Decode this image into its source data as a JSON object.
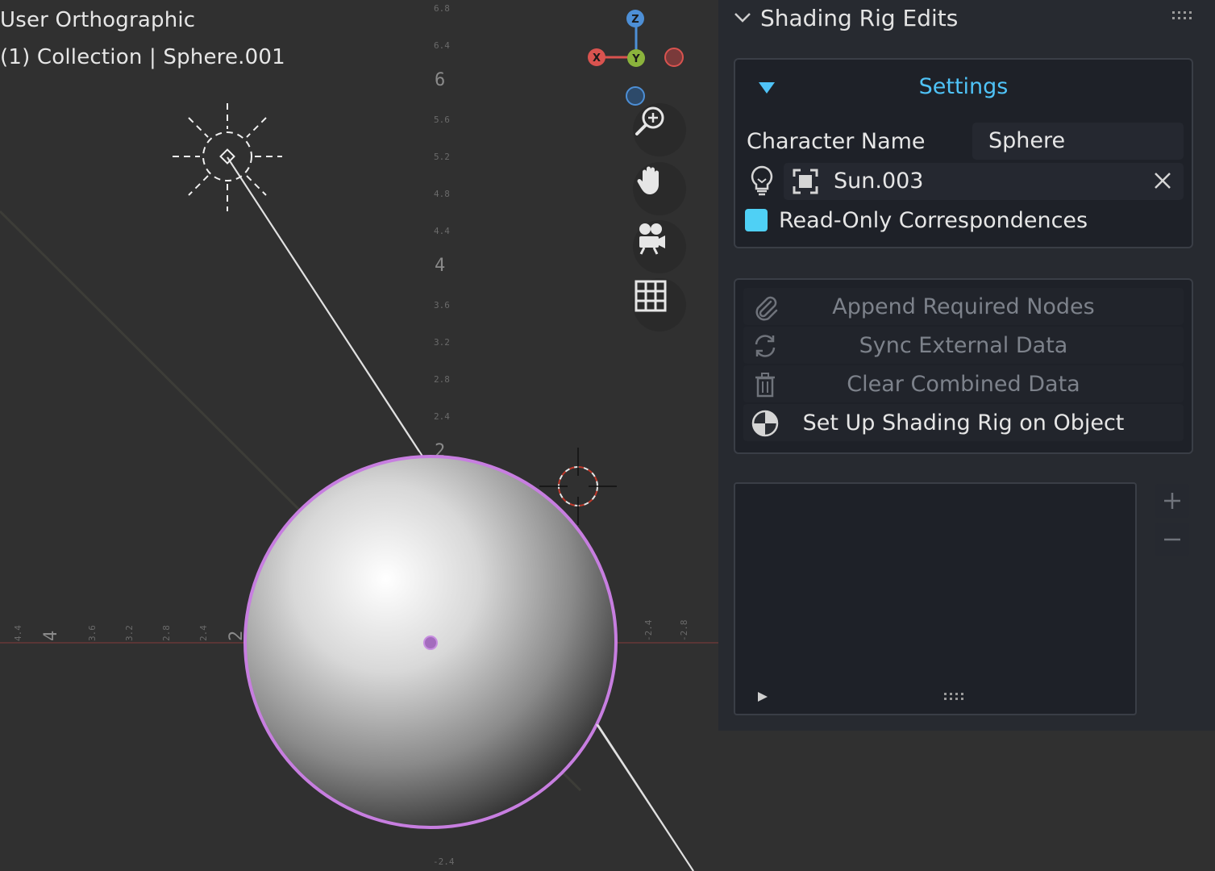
{
  "viewport": {
    "view_name": "User Orthographic",
    "collection_line": "(1) Collection | Sphere.001",
    "gizmo_labels": {
      "x": "X",
      "y": "Y",
      "z": "Z"
    },
    "ruler_vertical": [
      "6.8",
      "6.4",
      "6",
      "5.6",
      "5.2",
      "4.8",
      "4.4",
      "4",
      "3.6",
      "3.2",
      "2.8",
      "2.4",
      "2",
      "-2.4"
    ],
    "ruler_horizontal": [
      "4.4",
      "4",
      "3.6",
      "3.2",
      "2.8",
      "2.4",
      "2",
      "-2.4",
      "-2.8"
    ],
    "colors": {
      "background": "#303030",
      "selection_outline": "#c77ee0",
      "x_axis": "#d9534f",
      "y_axis": "#8bb33c",
      "z_axis": "#4d8fd6"
    },
    "nav_icons": [
      "zoom-icon",
      "pan-hand-icon",
      "camera-icon",
      "grid-icon"
    ]
  },
  "sidebar": {
    "panel_title": "Shading Rig Edits",
    "settings": {
      "label": "Settings",
      "character_name_label": "Character Name",
      "character_name_value": "Sphere",
      "light_object_value": "Sun.003",
      "read_only_label": "Read-Only Correspondences",
      "read_only_checked": true
    },
    "actions": [
      {
        "label": "Append Required Nodes",
        "icon": "paperclip-icon",
        "enabled": false
      },
      {
        "label": "Sync External Data",
        "icon": "sync-icon",
        "enabled": false
      },
      {
        "label": "Clear Combined Data",
        "icon": "trash-icon",
        "enabled": false
      },
      {
        "label": "Set Up Shading Rig on Object",
        "icon": "shading-icon",
        "enabled": true
      }
    ],
    "accent_color": "#4fc3f7"
  }
}
